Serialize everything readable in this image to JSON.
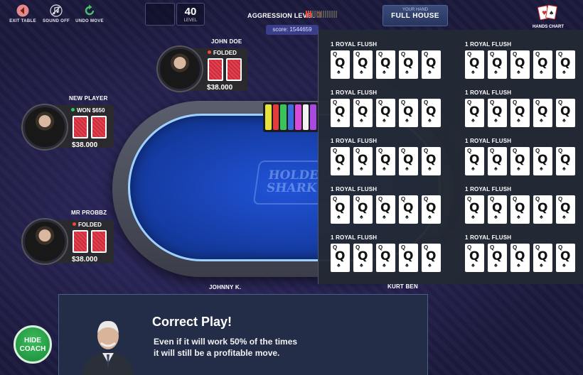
{
  "toolbar": {
    "exit_label": "EXIT TABLE",
    "sound_label": "SOUND OFF",
    "undo_label": "UNDO MOVE",
    "level_value": "40",
    "level_label": "LEVEL",
    "aggression_label": "AGGRESSION LEVEL",
    "aggression_value": "3",
    "aggression_level": 3,
    "aggression_max": 15,
    "score_text": "score: 1544659",
    "hand_label": "YOUR HAND",
    "hand_value": "FULL HOUSE",
    "hands_chart_label": "HANDS CHART"
  },
  "players": {
    "john_doe": {
      "name": "JOHN DOE",
      "status": "FOLDED",
      "stack": "$38.000"
    },
    "new_player": {
      "name": "NEW PLAYER",
      "status": "WON $650",
      "stack": "$38.000"
    },
    "mr_probbz": {
      "name": "MR PROBBZ",
      "status": "FOLDED",
      "stack": "$38.000"
    },
    "johnny_k": {
      "name": "JOHNNY K."
    },
    "kurt_ben": {
      "name": "KURT BEN"
    }
  },
  "table": {
    "logo_line1": "HOLDEM",
    "logo_line2": "SHARK"
  },
  "hands_chart": {
    "groups": [
      {
        "title": "1 ROYAL FLUSH",
        "cards": [
          "Q",
          "Q",
          "Q",
          "Q",
          "Q"
        ]
      },
      {
        "title": "1 ROYAL FLUSH",
        "cards": [
          "Q",
          "Q",
          "Q",
          "Q",
          "Q"
        ]
      },
      {
        "title": "1 ROYAL FLUSH",
        "cards": [
          "Q",
          "Q",
          "Q",
          "Q",
          "Q"
        ]
      },
      {
        "title": "1 ROYAL FLUSH",
        "cards": [
          "Q",
          "Q",
          "Q",
          "Q",
          "Q"
        ]
      },
      {
        "title": "1 ROYAL FLUSH",
        "cards": [
          "Q",
          "Q",
          "Q",
          "Q",
          "Q"
        ]
      },
      {
        "title": "1 ROYAL FLUSH",
        "cards": [
          "Q",
          "Q",
          "Q",
          "Q",
          "Q"
        ]
      },
      {
        "title": "1 ROYAL FLUSH",
        "cards": [
          "Q",
          "Q",
          "Q",
          "Q",
          "Q"
        ]
      },
      {
        "title": "1 ROYAL FLUSH",
        "cards": [
          "Q",
          "Q",
          "Q",
          "Q",
          "Q"
        ]
      },
      {
        "title": "1 ROYAL FLUSH",
        "cards": [
          "Q",
          "Q",
          "Q",
          "Q",
          "Q"
        ]
      },
      {
        "title": "1 ROYAL FLUSH",
        "cards": [
          "Q",
          "Q",
          "Q",
          "Q",
          "Q"
        ]
      }
    ]
  },
  "coach": {
    "title": "Correct Play!",
    "line1": "Even if it will work 50% of the times",
    "line2": "it will still be a profitable move.",
    "hide_label_1": "HIDE",
    "hide_label_2": "COACH"
  },
  "colors": {
    "accent_red": "#e94b3c",
    "felt_blue": "#1f4fd0",
    "won_green": "#38c26a",
    "hide_coach_green": "#2aa14b"
  },
  "icons": {
    "exit": "back-arrow-icon",
    "sound": "music-note-off-icon",
    "undo": "undo-arrow-icon",
    "hands_chart": "playing-cards-icon",
    "card_suit": "spade-icon"
  }
}
